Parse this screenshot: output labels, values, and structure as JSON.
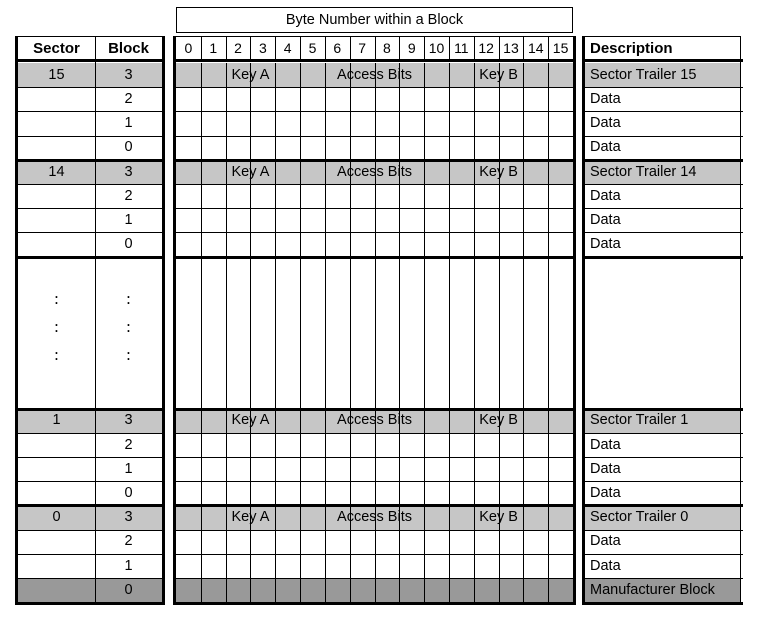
{
  "diagram": {
    "title_byte_header": "Byte Number within a Block",
    "columns": {
      "sector": "Sector",
      "block": "Block",
      "description": "Description"
    },
    "byte_numbers": [
      "0",
      "1",
      "2",
      "3",
      "4",
      "5",
      "6",
      "7",
      "8",
      "9",
      "10",
      "11",
      "12",
      "13",
      "14",
      "15"
    ],
    "trailer_fields": [
      {
        "label": "Key A",
        "bytes": "0-5"
      },
      {
        "label": "Access Bits",
        "bytes": "6-9"
      },
      {
        "label": "Key B",
        "bytes": "10-15"
      }
    ],
    "ellipsis": ":",
    "sectors": [
      {
        "sector": "15",
        "rows": [
          {
            "block": "3",
            "description": "Sector Trailer 15",
            "type": "trailer",
            "shade": "light"
          },
          {
            "block": "2",
            "description": "Data",
            "type": "data",
            "shade": "none"
          },
          {
            "block": "1",
            "description": "Data",
            "type": "data",
            "shade": "none"
          },
          {
            "block": "0",
            "description": "Data",
            "type": "data",
            "shade": "none"
          }
        ]
      },
      {
        "sector": "14",
        "rows": [
          {
            "block": "3",
            "description": "Sector Trailer 14",
            "type": "trailer",
            "shade": "light"
          },
          {
            "block": "2",
            "description": "Data",
            "type": "data",
            "shade": "none"
          },
          {
            "block": "1",
            "description": "Data",
            "type": "data",
            "shade": "none"
          },
          {
            "block": "0",
            "description": "Data",
            "type": "data",
            "shade": "none"
          }
        ]
      },
      {
        "sector": ":",
        "rows": [
          {
            "block": ":",
            "description": "",
            "type": "ellipsis",
            "shade": "none"
          }
        ]
      },
      {
        "sector": "1",
        "rows": [
          {
            "block": "3",
            "description": "Sector Trailer 1",
            "type": "trailer",
            "shade": "light"
          },
          {
            "block": "2",
            "description": "Data",
            "type": "data",
            "shade": "none"
          },
          {
            "block": "1",
            "description": "Data",
            "type": "data",
            "shade": "none"
          },
          {
            "block": "0",
            "description": "Data",
            "type": "data",
            "shade": "none"
          }
        ]
      },
      {
        "sector": "0",
        "rows": [
          {
            "block": "3",
            "description": "Sector Trailer 0",
            "type": "trailer",
            "shade": "light"
          },
          {
            "block": "2",
            "description": "Data",
            "type": "data",
            "shade": "none"
          },
          {
            "block": "1",
            "description": "Data",
            "type": "data",
            "shade": "none"
          },
          {
            "block": "0",
            "description": "Manufacturer Block",
            "type": "manufacturer",
            "shade": "dark"
          }
        ]
      }
    ],
    "colors": {
      "trailer_fill": "#c6c6c6",
      "manufacturer_fill": "#999999",
      "line": "#000000",
      "background": "#ffffff"
    }
  }
}
